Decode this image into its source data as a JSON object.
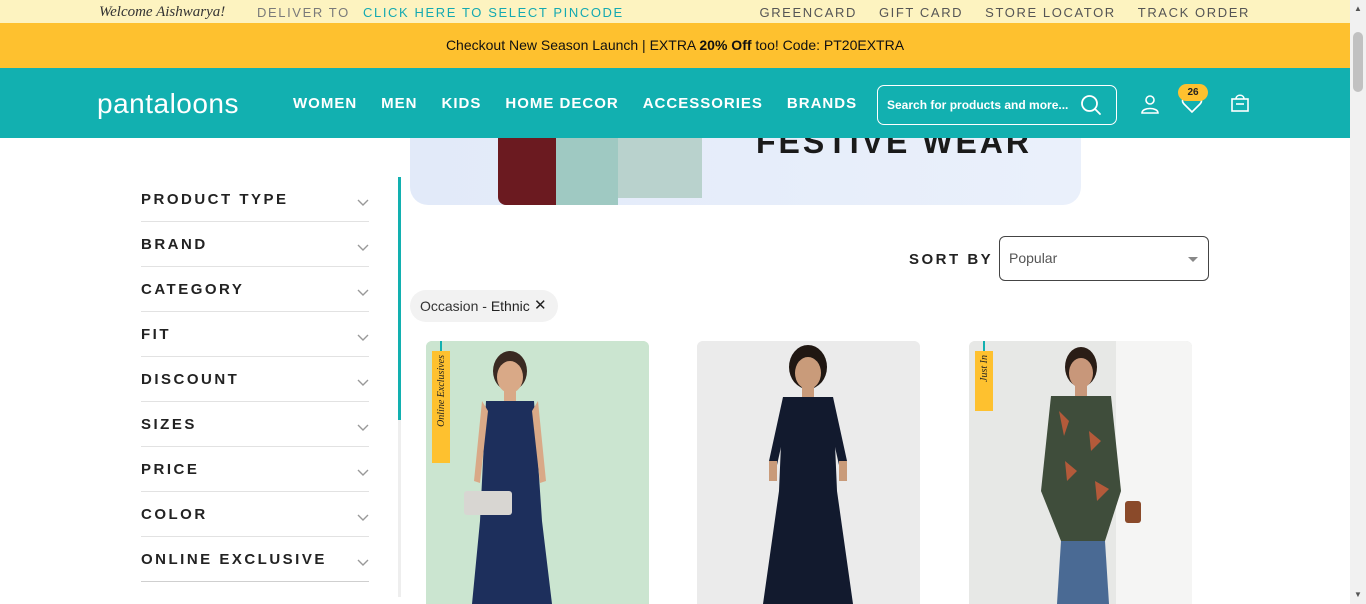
{
  "topbar": {
    "welcome": "Welcome Aishwarya!",
    "deliver_to": "DELIVER TO",
    "pincode": "CLICK HERE TO SELECT PINCODE",
    "links": [
      "GREENCARD",
      "GIFT CARD",
      "STORE LOCATOR",
      "TRACK ORDER"
    ]
  },
  "promo": {
    "text_before": "Checkout New Season Launch | EXTRA ",
    "bold": "20% Off",
    "text_after": " too! Code: PT20EXTRA"
  },
  "nav": {
    "logo": "pantaloons",
    "menu": [
      "WOMEN",
      "MEN",
      "KIDS",
      "HOME DECOR",
      "ACCESSORIES",
      "BRANDS"
    ],
    "search_placeholder": "Search for products and more...",
    "wishlist_count": "26",
    "icons": [
      "search-icon",
      "user-icon",
      "heart-icon",
      "bag-icon"
    ]
  },
  "banner": {
    "title": "FESTIVE WEAR"
  },
  "filters": [
    "PRODUCT TYPE",
    "BRAND",
    "CATEGORY",
    "FIT",
    "DISCOUNT",
    "SIZES",
    "PRICE",
    "COLOR",
    "ONLINE EXCLUSIVE"
  ],
  "sort": {
    "label": "SORT BY",
    "selected": "Popular"
  },
  "applied_filter": {
    "label": "Occasion - ",
    "value": "Ethnic"
  },
  "products": [
    {
      "tag": "Online Exclusives",
      "image": "woman in navy printed sleeveless kurta"
    },
    {
      "tag": "",
      "image": "woman in navy tiered maxi dress"
    },
    {
      "tag": "Just In",
      "image": "woman in floral print high-low shirt"
    }
  ],
  "colors": {
    "teal": "#12b0b0",
    "yellow": "#fec12f",
    "cream": "#fdf3c0"
  }
}
